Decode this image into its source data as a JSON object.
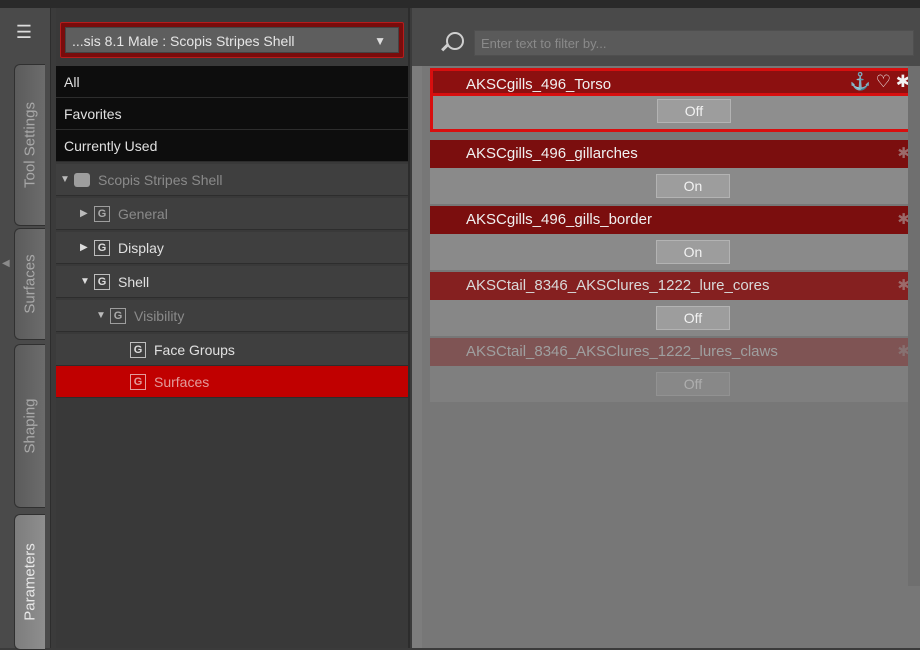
{
  "tabs": [
    {
      "label": "Tool Settings",
      "active": false
    },
    {
      "label": "Surfaces",
      "active": false
    },
    {
      "label": "Shaping",
      "active": false
    },
    {
      "label": "Parameters",
      "active": true
    }
  ],
  "node_dropdown": {
    "value": "...sis 8.1 Male : Scopis Stripes Shell"
  },
  "tree": {
    "fixed_items": [
      "All",
      "Favorites",
      "Currently Used"
    ],
    "node": "Scopis Stripes Shell",
    "groups": [
      {
        "label": "General"
      },
      {
        "label": "Display"
      },
      {
        "label": "Shell"
      },
      {
        "label": "Visibility"
      },
      {
        "label": "Face Groups"
      },
      {
        "label": "Surfaces"
      }
    ]
  },
  "filter": {
    "placeholder": "Enter text to filter by..."
  },
  "parameters": [
    {
      "name": "AKSCgills_496_Torso",
      "state": "Off",
      "highlighted": true
    },
    {
      "name": "AKSCgills_496_gillarches",
      "state": "On"
    },
    {
      "name": "AKSCgills_496_gills_border",
      "state": "On"
    },
    {
      "name": "AKSCtail_8346_AKSClures_1222_lure_cores",
      "state": "Off"
    },
    {
      "name": "AKSCtail_8346_AKSClures_1222_lures_claws",
      "state": "Off"
    }
  ],
  "colors": {
    "accent": "#c00000",
    "outline": "#e01010"
  },
  "icons": {
    "link": "link-icon",
    "favorite": "heart-icon",
    "settings": "gear-icon",
    "search": "search-icon"
  }
}
